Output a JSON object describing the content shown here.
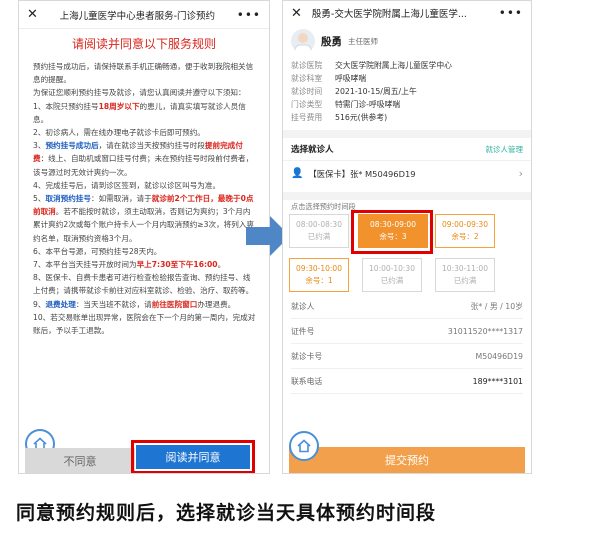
{
  "left": {
    "title": "上海儿童医学中心患者服务-门诊预约",
    "rules_heading": "请阅读并同意以下服务规则",
    "rules": [
      [
        {
          "t": "预约挂号成功后，请保持联系手机正确畅通，便于收到我院相关信息的提醒。"
        }
      ],
      [
        {
          "t": "为保证您顺利预约挂号及就诊，请您认真阅读并遵守以下须知："
        }
      ],
      [
        {
          "t": "1、本院只预约挂号"
        },
        {
          "t": "18周岁以下",
          "c": "red"
        },
        {
          "t": "的患儿，请真实填写就诊人员信息。"
        }
      ],
      [
        {
          "t": "2、初诊病人，需在线办理电子就诊卡后即可预约。"
        }
      ],
      [
        {
          "t": "3、"
        },
        {
          "t": "预约挂号成功后",
          "c": "blue"
        },
        {
          "t": "，请在就诊当天按预约挂号时段"
        },
        {
          "t": "提前完成付费",
          "c": "red"
        },
        {
          "t": "：线上、自助机或窗口挂号付费；未在预约挂号时段前付费者，该号源过时无效计爽约一次。"
        }
      ],
      [
        {
          "t": "4、完成挂号后，请到诊区签到，就诊以诊区叫号为准。"
        }
      ],
      [
        {
          "t": "5、"
        },
        {
          "t": "取消预约挂号",
          "c": "blue"
        },
        {
          "t": "：如需取消，请于"
        },
        {
          "t": "就诊前2个工作日，最晚于0点前取消",
          "c": "red"
        },
        {
          "t": "。若不能按时就诊，须主动取消，否则记为爽约；3个月内累计爽约2次或每个账户持卡人一个月内取消预约≥3次，将列入爽约名单，取消预约资格3个月。"
        }
      ],
      [
        {
          "t": "6、本平台号源，可预约挂号28天内。"
        }
      ],
      [
        {
          "t": "7、本平台当天挂号开放时间为"
        },
        {
          "t": "早上7:30至下午16:00",
          "c": "red"
        },
        {
          "t": "。"
        }
      ],
      [
        {
          "t": "8、医保卡、自费卡患者可进行检查检验报告查询、预约挂号、线上付费；请携带就诊卡前往对应科室就诊、检验、治疗、取药等。"
        }
      ],
      [
        {
          "t": "9、"
        },
        {
          "t": "退费处理",
          "c": "blue"
        },
        {
          "t": "：当天当班不就诊，请"
        },
        {
          "t": "前往医院窗口",
          "c": "red"
        },
        {
          "t": "办理退费。"
        }
      ],
      [
        {
          "t": "10、若交易账单出现异常，医院会在下一个月的第一周内，完成对账后，予以手工退款。"
        }
      ]
    ],
    "disagree_label": "不同意",
    "agree_label": "阅读并同意"
  },
  "right": {
    "title": "殷勇-交大医学院附属上海儿童医学...",
    "doctor_name": "殷勇",
    "doctor_role": "主任医师",
    "info": [
      {
        "k": "就诊医院",
        "v": "交大医学院附属上海儿童医学中心"
      },
      {
        "k": "就诊科室",
        "v": "呼吸哮喘"
      },
      {
        "k": "就诊时间",
        "v": "2021-10-15/周五/上午"
      },
      {
        "k": "门诊类型",
        "v": "特需门诊-呼吸哮喘"
      },
      {
        "k": "挂号费用",
        "v": "516元(供参考)"
      }
    ],
    "patient_section": "选择就诊人",
    "patient_manage": "就诊人管理",
    "patient_card": "【医保卡】张* M50496D19",
    "slot_hint": "点击选择预约时间段",
    "slots": [
      {
        "time": "08:00-08:30",
        "status": "已约满",
        "state": "full"
      },
      {
        "time": "08:30-09:00",
        "status": "余号：3",
        "state": "selected"
      },
      {
        "time": "09:00-09:30",
        "status": "余号：2",
        "state": "avail"
      },
      {
        "time": "09:30-10:00",
        "status": "余号：1",
        "state": "avail"
      },
      {
        "time": "10:00-10:30",
        "status": "已约满",
        "state": "full"
      },
      {
        "time": "10:30-11:00",
        "status": "已约满",
        "state": "full"
      }
    ],
    "form": [
      {
        "k": "就诊人",
        "v": "张* / 男 / 10岁",
        "bold": false
      },
      {
        "k": "证件号",
        "v": "31011520****1317",
        "bold": false
      },
      {
        "k": "就诊卡号",
        "v": "M50496D19",
        "bold": false
      },
      {
        "k": "联系电话",
        "v": "189****3101",
        "bold": true
      }
    ],
    "submit_label": "提交预约"
  },
  "caption": "同意预约规则后，选择就诊当天具体预约时间段",
  "colors": {
    "red": "#d9261c",
    "blue": "#1f76d2",
    "orange": "#f1922d",
    "highlight": "#e00000",
    "arrow": "#4f86c6"
  }
}
